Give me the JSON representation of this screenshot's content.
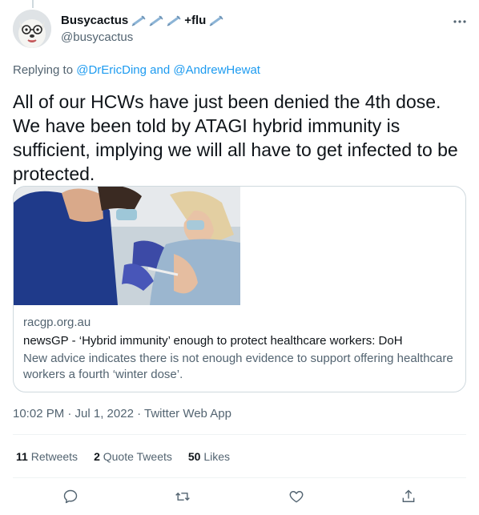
{
  "tweet": {
    "author_name": "Busycactus",
    "author_suffix": "+flu",
    "handle": "@busycactus",
    "more_icon": "more-dots-icon",
    "replying_prefix": "Replying to",
    "reply_user_1": "@DrEricDing",
    "reply_and": "and",
    "reply_user_2": "@AndrewHewat",
    "text": "All of our HCWs have just been denied the 4th dose. We have been told by ATAGI hybrid immunity is sufficient, implying we will all have to get infected to be protected.",
    "timestamp": "10:02 PM · Jul 1, 2022 · Twitter Web App"
  },
  "card": {
    "domain": "racgp.org.au",
    "title": "newsGP - ‘Hybrid immunity’ enough to protect healthcare workers: DoH",
    "description": "New advice indicates there is not enough evidence to support offering healthcare workers a fourth ‘winter dose’."
  },
  "stats": {
    "retweets_count": "11",
    "retweets_label": "Retweets",
    "quotes_count": "2",
    "quotes_label": "Quote Tweets",
    "likes_count": "50",
    "likes_label": "Likes"
  },
  "actions": [
    "reply-icon",
    "retweet-icon",
    "like-icon",
    "share-icon"
  ],
  "colors": {
    "link": "#1d9bf0",
    "secondary_text": "#536471",
    "border": "#cfd9de",
    "syringe": "#8cb4d6"
  }
}
